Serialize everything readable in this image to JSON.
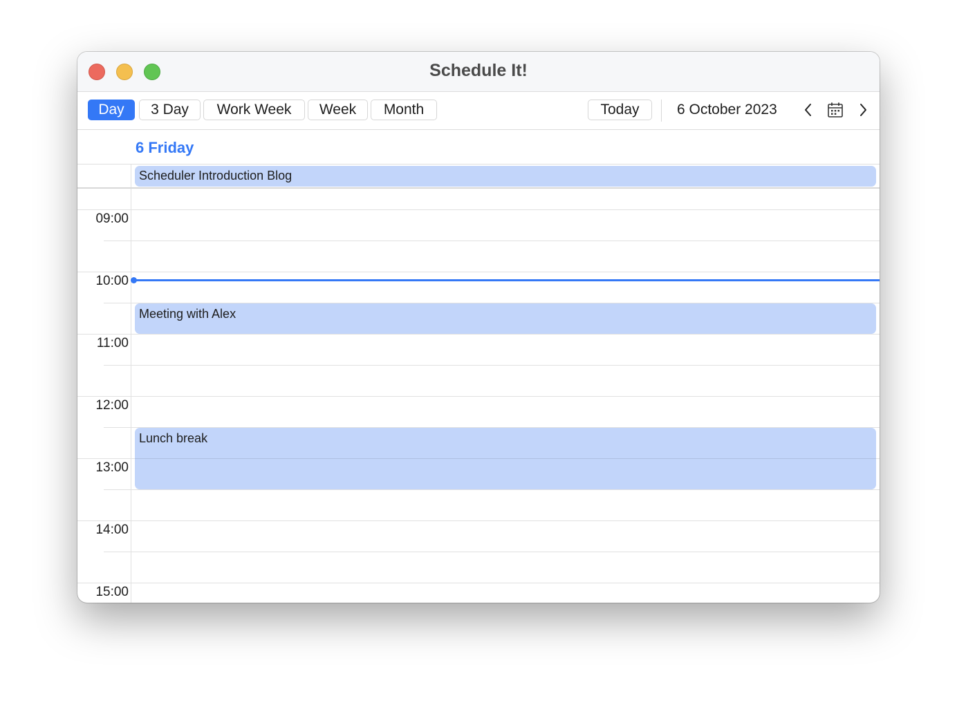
{
  "window": {
    "title": "Schedule It!"
  },
  "toolbar": {
    "views": [
      {
        "label": "Day",
        "active": true
      },
      {
        "label": "3 Day",
        "active": false
      },
      {
        "label": "Work Week",
        "active": false
      },
      {
        "label": "Week",
        "active": false
      },
      {
        "label": "Month",
        "active": false
      }
    ],
    "today_label": "Today",
    "current_date": "6 October 2023",
    "icons": {
      "prev": "chevron-left-icon",
      "calendar": "calendar-icon",
      "next": "chevron-right-icon"
    }
  },
  "day_header": {
    "label": "6 Friday"
  },
  "all_day_events": [
    {
      "title": "Scheduler Introduction Blog"
    }
  ],
  "hours": [
    "09:00",
    "10:00",
    "11:00",
    "12:00",
    "13:00",
    "14:00",
    "15:00"
  ],
  "current_time": "10:08",
  "events": [
    {
      "title": "Meeting with Alex",
      "start": "10:30",
      "end": "11:00"
    },
    {
      "title": "Lunch break",
      "start": "12:30",
      "end": "13:30"
    }
  ],
  "colors": {
    "accent": "#3478f6",
    "event_fill": "#c2d5fa"
  }
}
